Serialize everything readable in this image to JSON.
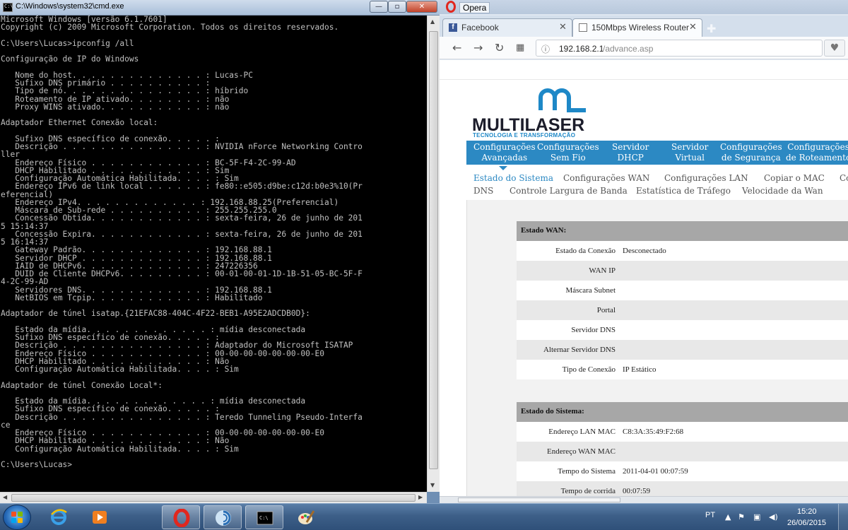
{
  "cmd": {
    "title": "C:\\Windows\\system32\\cmd.exe",
    "icon_label": "C:\\",
    "minimize": "—",
    "maximize": "▫",
    "close": "✕",
    "lines": [
      "Microsoft Windows [versão 6.1.7601]",
      "Copyright (c) 2009 Microsoft Corporation. Todos os direitos reservados.",
      "",
      "C:\\Users\\Lucas>ipconfig /all",
      "",
      "Configuração de IP do Windows",
      "",
      "   Nome do host. . . . . . . . . . . . . . : Lucas-PC",
      "   Sufixo DNS primário . . . . . . . . . . :",
      "   Tipo de nó. . . . . . . . . . . . . . . : híbrido",
      "   Roteamento de IP ativado. . . . . . . . : não",
      "   Proxy WINS ativado. . . . . . . . . . . : não",
      "",
      "Adaptador Ethernet Conexão local:",
      "",
      "   Sufixo DNS específico de conexão. . . . . :",
      "   Descrição . . . . . . . . . . . . . . . : NVIDIA nForce Networking Contro",
      "ller",
      "   Endereço Físico . . . . . . . . . . . . : BC-5F-F4-2C-99-AD",
      "   DHCP Habilitado . . . . . . . . . . . . : Sim",
      "   Configuração Automática Habilitada. . . . : Sim",
      "   Endereço IPv6 de link local . . . . . . : fe80::e505:d9be:c12d:b0e3%10(Pr",
      "eferencial)",
      "   Endereço IPv4. . . . . . . . . . . . . : 192.168.88.25(Preferencial)",
      "   Máscara de Sub-rede . . . . . . . . . . : 255.255.255.0",
      "   Concessão Obtida. . . . . . . . . . . . : sexta-feira, 26 de junho de 201",
      "5 15:14:37",
      "   Concessão Expira. . . . . . . . . . . . : sexta-feira, 26 de junho de 201",
      "5 16:14:37",
      "   Gateway Padrão. . . . . . . . . . . . . : 192.168.88.1",
      "   Servidor DHCP . . . . . . . . . . . . . : 192.168.88.1",
      "   IAID de DHCPv6. . . . . . . . . . . . . : 247226356",
      "   DUID de Cliente DHCPv6. . . . . . . . . : 00-01-00-01-1D-1B-51-05-BC-5F-F",
      "4-2C-99-AD",
      "   Servidores DNS. . . . . . . . . . . . . : 192.168.88.1",
      "   NetBIOS em Tcpip. . . . . . . . . . . . : Habilitado",
      "",
      "Adaptador de túnel isatap.{21EFAC88-404C-4F22-BEB1-A95E2ADCDB0D}:",
      "",
      "   Estado da mídia. . . . . . . . . . . . . : mídia desconectada",
      "   Sufixo DNS específico de conexão. . . . . :",
      "   Descrição . . . . . . . . . . . . . . . : Adaptador do Microsoft ISATAP",
      "   Endereço Físico . . . . . . . . . . . . : 00-00-00-00-00-00-00-E0",
      "   DHCP Habilitado . . . . . . . . . . . . : Não",
      "   Configuração Automática Habilitada. . . . : Sim",
      "",
      "Adaptador de túnel Conexão Local*:",
      "",
      "   Estado da mídia. . . . . . . . . . . . . : mídia desconectada",
      "   Sufixo DNS específico de conexão. . . . . :",
      "   Descrição . . . . . . . . . . . . . . . : Teredo Tunneling Pseudo-Interfa",
      "ce",
      "   Endereço Físico . . . . . . . . . . . . : 00-00-00-00-00-00-00-E0",
      "   DHCP Habilitado . . . . . . . . . . . . : Não",
      "   Configuração Automática Habilitada. . . . : Sim",
      "",
      "C:\\Users\\Lucas>"
    ]
  },
  "opera": {
    "menu_label": "Opera",
    "tabs": [
      {
        "label": "Facebook",
        "icon": "facebook-icon",
        "close": "✕"
      },
      {
        "label": "150Mbps Wireless Router",
        "icon": "page-icon",
        "close": "✕"
      }
    ],
    "new_tab": "✚",
    "address": {
      "host": "192.168.2.1",
      "path": "/advance.asp"
    },
    "nav": {
      "back": "←",
      "forward": "→",
      "reload": "↻",
      "speed_dial": "▦",
      "heart": "♥"
    }
  },
  "router_page": {
    "logo_text": "MULTILASER",
    "logo_sub": "TECNOLOGIA E TRANSFORMAÇÃO",
    "main_menu": [
      {
        "l1": "Configurações",
        "l2": "Avançadas"
      },
      {
        "l1": "Configurações",
        "l2": "Sem Fio"
      },
      {
        "l1": "Servidor",
        "l2": "DHCP"
      },
      {
        "l1": "Servidor",
        "l2": "Virtual"
      },
      {
        "l1": "Configurações",
        "l2": "de Segurança"
      },
      {
        "l1": "Configurações",
        "l2": "de Roteamento"
      }
    ],
    "sub_menu": [
      "Estado do Sistema",
      "Configurações WAN",
      "Configurações LAN",
      "Copiar o MAC",
      "Co",
      "DNS",
      "Controle Largura de Banda",
      "Estatística de Tráfego",
      "Velocidade da Wan"
    ],
    "wan_section": {
      "title": "Estado WAN:",
      "rows": [
        {
          "label": "Estado da Conexão",
          "value": "Desconectado"
        },
        {
          "label": "WAN IP",
          "value": ""
        },
        {
          "label": "Máscara Subnet",
          "value": ""
        },
        {
          "label": "Portal",
          "value": ""
        },
        {
          "label": "Servidor DNS",
          "value": ""
        },
        {
          "label": "Alternar Servidor DNS",
          "value": ""
        },
        {
          "label": "Tipo de Conexão",
          "value": "IP Estático"
        }
      ]
    },
    "system_section": {
      "title": "Estado do Sistema:",
      "rows": [
        {
          "label": "Endereço LAN MAC",
          "value": "C8:3A:35:49:F2:68"
        },
        {
          "label": "Endereço WAN MAC",
          "value": ""
        },
        {
          "label": "Tempo do Sistema",
          "value": "2011-04-01 00:07:59"
        },
        {
          "label": "Tempo de corrida",
          "value": "00:07:59"
        }
      ]
    }
  },
  "taskbar": {
    "apps": [
      "start-button",
      "internet-explorer-icon",
      "windows-media-player-icon",
      "opera-icon",
      "network-icon",
      "cmd-icon",
      "paint-icon"
    ],
    "tray": {
      "lang": "PT",
      "time": "15:20",
      "date": "26/06/2015"
    }
  }
}
